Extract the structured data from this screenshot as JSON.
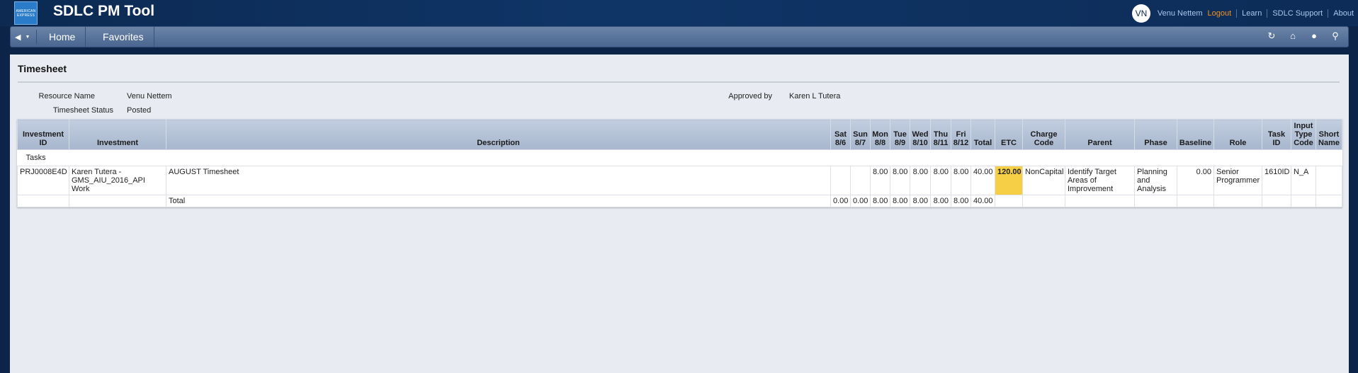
{
  "header": {
    "logo_text": "AMERICAN EXPRESS",
    "app_title": "SDLC PM Tool",
    "user_initials": "VN",
    "user_name": "Venu Nettem",
    "links": [
      "Logout",
      "Learn",
      "SDLC Support",
      "About"
    ]
  },
  "nav": {
    "items": [
      "Home",
      "Favorites"
    ],
    "icons": [
      "refresh-icon",
      "home-icon",
      "help-icon",
      "search-icon"
    ]
  },
  "page": {
    "title": "Timesheet",
    "fields": {
      "resource_name_label": "Resource Name",
      "resource_name": "Venu Nettem",
      "approved_by_label": "Approved by",
      "approved_by": "Karen L Tutera",
      "status_label": "Timesheet Status",
      "status": "Posted"
    }
  },
  "table": {
    "columns": [
      "Investment ID",
      "Investment",
      "Description",
      "Sat 8/6",
      "Sun 8/7",
      "Mon 8/8",
      "Tue 8/9",
      "Wed 8/10",
      "Thu 8/11",
      "Fri 8/12",
      "Total",
      "ETC",
      "Charge Code",
      "Parent",
      "Phase",
      "Baseline",
      "Role",
      "Task ID",
      "Input Type Code",
      "Short Name"
    ],
    "group_label": "Tasks",
    "row": {
      "investment_id": "PRJ0008E4D",
      "investment": "Karen Tutera - GMS_AIU_2016_API Work",
      "description": "AUGUST Timesheet",
      "sat": "",
      "sun": "",
      "mon": "8.00",
      "tue": "8.00",
      "wed": "8.00",
      "thu": "8.00",
      "fri": "8.00",
      "total": "40.00",
      "etc": "120.00",
      "charge_code": "NonCapital",
      "parent": "Identify Target Areas of Improvement",
      "phase": "Planning and Analysis",
      "baseline": "0.00",
      "role": "Senior Programmer",
      "task_id": "1610ID",
      "input_type_code": "N_A",
      "short_name": ""
    },
    "totals": {
      "label": "Total",
      "sat": "0.00",
      "sun": "0.00",
      "mon": "8.00",
      "tue": "8.00",
      "wed": "8.00",
      "thu": "8.00",
      "fri": "8.00",
      "total": "40.00"
    }
  },
  "colors": {
    "banner": "#0c2a52",
    "nav": "#5a7399",
    "accent_logout": "#f2931e",
    "etc_highlight": "#f6cf46"
  }
}
